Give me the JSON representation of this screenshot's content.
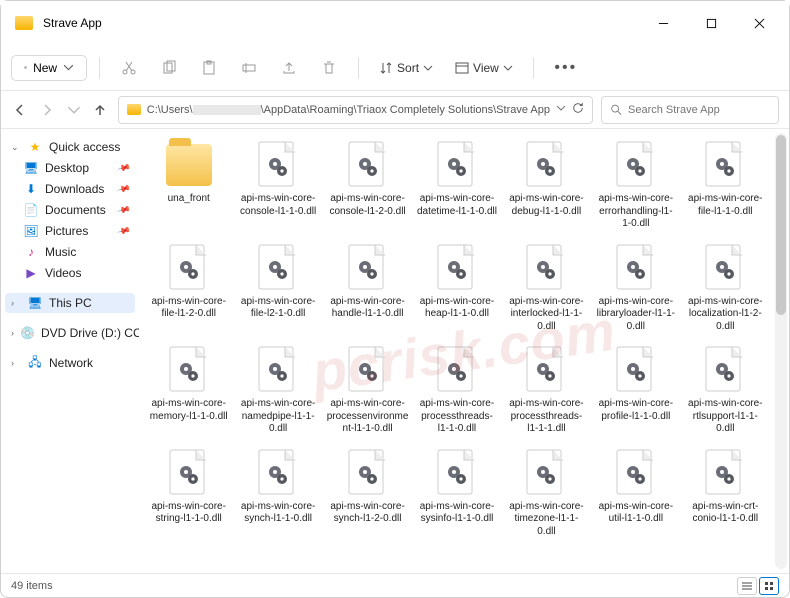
{
  "title": "Strave App",
  "toolbar": {
    "new_label": "New",
    "sort_label": "Sort",
    "view_label": "View"
  },
  "address": {
    "prefix": "C:\\Users\\",
    "suffix": "\\AppData\\Roaming\\Triaox Completely Solutions\\Strave App"
  },
  "search_placeholder": "Search Strave App",
  "sidebar": {
    "quick": "Quick access",
    "desktop": "Desktop",
    "downloads": "Downloads",
    "documents": "Documents",
    "pictures": "Pictures",
    "music": "Music",
    "videos": "Videos",
    "thispc": "This PC",
    "dvd": "DVD Drive (D:) CCCC",
    "network": "Network"
  },
  "files": [
    {
      "name": "una_front",
      "type": "folder"
    },
    {
      "name": "api-ms-win-core-console-l1-1-0.dll",
      "type": "dll"
    },
    {
      "name": "api-ms-win-core-console-l1-2-0.dll",
      "type": "dll"
    },
    {
      "name": "api-ms-win-core-datetime-l1-1-0.dll",
      "type": "dll"
    },
    {
      "name": "api-ms-win-core-debug-l1-1-0.dll",
      "type": "dll"
    },
    {
      "name": "api-ms-win-core-errorhandling-l1-1-0.dll",
      "type": "dll"
    },
    {
      "name": "api-ms-win-core-file-l1-1-0.dll",
      "type": "dll"
    },
    {
      "name": "api-ms-win-core-file-l1-2-0.dll",
      "type": "dll"
    },
    {
      "name": "api-ms-win-core-file-l2-1-0.dll",
      "type": "dll"
    },
    {
      "name": "api-ms-win-core-handle-l1-1-0.dll",
      "type": "dll"
    },
    {
      "name": "api-ms-win-core-heap-l1-1-0.dll",
      "type": "dll"
    },
    {
      "name": "api-ms-win-core-interlocked-l1-1-0.dll",
      "type": "dll"
    },
    {
      "name": "api-ms-win-core-libraryloader-l1-1-0.dll",
      "type": "dll"
    },
    {
      "name": "api-ms-win-core-localization-l1-2-0.dll",
      "type": "dll"
    },
    {
      "name": "api-ms-win-core-memory-l1-1-0.dll",
      "type": "dll"
    },
    {
      "name": "api-ms-win-core-namedpipe-l1-1-0.dll",
      "type": "dll"
    },
    {
      "name": "api-ms-win-core-processenvironment-l1-1-0.dll",
      "type": "dll"
    },
    {
      "name": "api-ms-win-core-processthreads-l1-1-0.dll",
      "type": "dll"
    },
    {
      "name": "api-ms-win-core-processthreads-l1-1-1.dll",
      "type": "dll"
    },
    {
      "name": "api-ms-win-core-profile-l1-1-0.dll",
      "type": "dll"
    },
    {
      "name": "api-ms-win-core-rtlsupport-l1-1-0.dll",
      "type": "dll"
    },
    {
      "name": "api-ms-win-core-string-l1-1-0.dll",
      "type": "dll"
    },
    {
      "name": "api-ms-win-core-synch-l1-1-0.dll",
      "type": "dll"
    },
    {
      "name": "api-ms-win-core-synch-l1-2-0.dll",
      "type": "dll"
    },
    {
      "name": "api-ms-win-core-sysinfo-l1-1-0.dll",
      "type": "dll"
    },
    {
      "name": "api-ms-win-core-timezone-l1-1-0.dll",
      "type": "dll"
    },
    {
      "name": "api-ms-win-core-util-l1-1-0.dll",
      "type": "dll"
    },
    {
      "name": "api-ms-win-crt-conio-l1-1-0.dll",
      "type": "dll"
    }
  ],
  "status": {
    "count": "49 items"
  },
  "watermark": "pcrisk.com"
}
